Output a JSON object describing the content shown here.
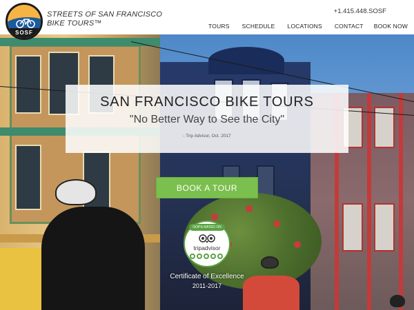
{
  "header": {
    "logo_text": "SOSF",
    "brand_line1": "STREETS OF SAN FRANCISCO",
    "brand_line2": "BIKE TOURS™",
    "phone": "+1.415.448.SOSF",
    "nav": [
      "TOURS",
      "SCHEDULE",
      "LOCATIONS",
      "CONTACT",
      "BOOK NOW"
    ]
  },
  "hero": {
    "title": "SAN FRANCISCO BIKE TOURS",
    "quote": "\"No Better Way to See the City\"",
    "attribution": "- Trip Advisor, Oct. 2017",
    "cta_label": "BOOK A TOUR"
  },
  "badge": {
    "ribbon": "OOPS-RATED ON",
    "brand": "tripadvisor",
    "certificate": "Certificate of Excellence",
    "years": "2011-2017",
    "icon": "tripadvisor-owl-icon"
  },
  "colors": {
    "cta_green": "#7bbf4e",
    "badge_green": "#5aa243"
  }
}
